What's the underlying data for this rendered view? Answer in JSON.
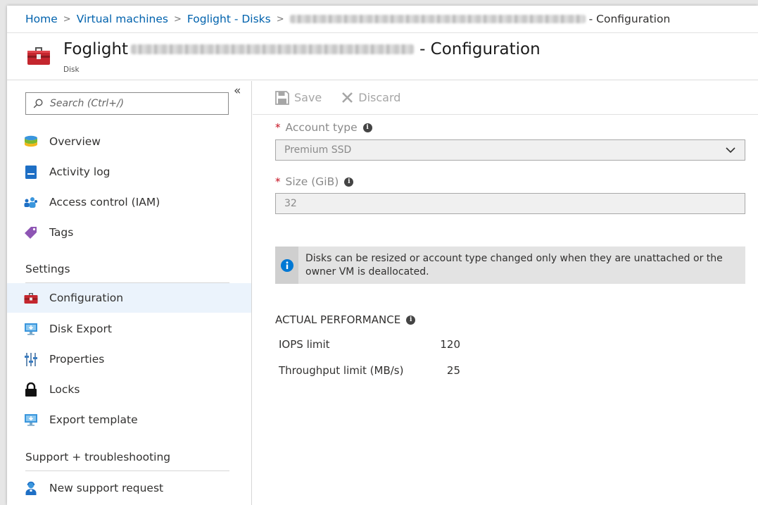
{
  "breadcrumb": {
    "items": [
      "Home",
      "Virtual machines",
      "Foglight - Disks"
    ],
    "current_suffix": "- Configuration",
    "separator": ">"
  },
  "resource": {
    "title_prefix": "Foglight",
    "title_suffix": "- Configuration",
    "subtitle": "Disk",
    "icon": "toolbox-icon"
  },
  "sidebar": {
    "collapse_glyph": "«",
    "search_placeholder": "Search (Ctrl+/)",
    "items": [
      {
        "label": "Overview",
        "icon": "overview-icon"
      },
      {
        "label": "Activity log",
        "icon": "activity-log-icon"
      },
      {
        "label": "Access control (IAM)",
        "icon": "iam-icon"
      },
      {
        "label": "Tags",
        "icon": "tag-icon"
      }
    ],
    "settings_header": "Settings",
    "settings_items": [
      {
        "label": "Configuration",
        "icon": "toolbox-icon",
        "active": true
      },
      {
        "label": "Disk Export",
        "icon": "monitor-icon"
      },
      {
        "label": "Properties",
        "icon": "properties-icon"
      },
      {
        "label": "Locks",
        "icon": "lock-icon"
      },
      {
        "label": "Export template",
        "icon": "monitor-icon"
      }
    ],
    "support_header": "Support + troubleshooting",
    "support_items": [
      {
        "label": "New support request",
        "icon": "support-person-icon"
      }
    ]
  },
  "toolbar": {
    "save_label": "Save",
    "discard_label": "Discard"
  },
  "form": {
    "required_marker": "*",
    "account_type_label": "Account type",
    "account_type_value": "Premium SSD",
    "size_label": "Size (GiB)",
    "size_value": "32",
    "info_glyph": "i"
  },
  "notice": {
    "text": "Disks can be resized or account type changed only when they are unattached or the owner VM is deallocated."
  },
  "performance": {
    "header": "ACTUAL PERFORMANCE",
    "rows": [
      {
        "label": "IOPS limit",
        "value": "120"
      },
      {
        "label": "Throughput limit (MB/s)",
        "value": "25"
      }
    ]
  },
  "colors": {
    "link": "#0062ad",
    "active_bg": "#ebf3fc",
    "required": "#c50f1f",
    "info_blue": "#0078d4"
  }
}
